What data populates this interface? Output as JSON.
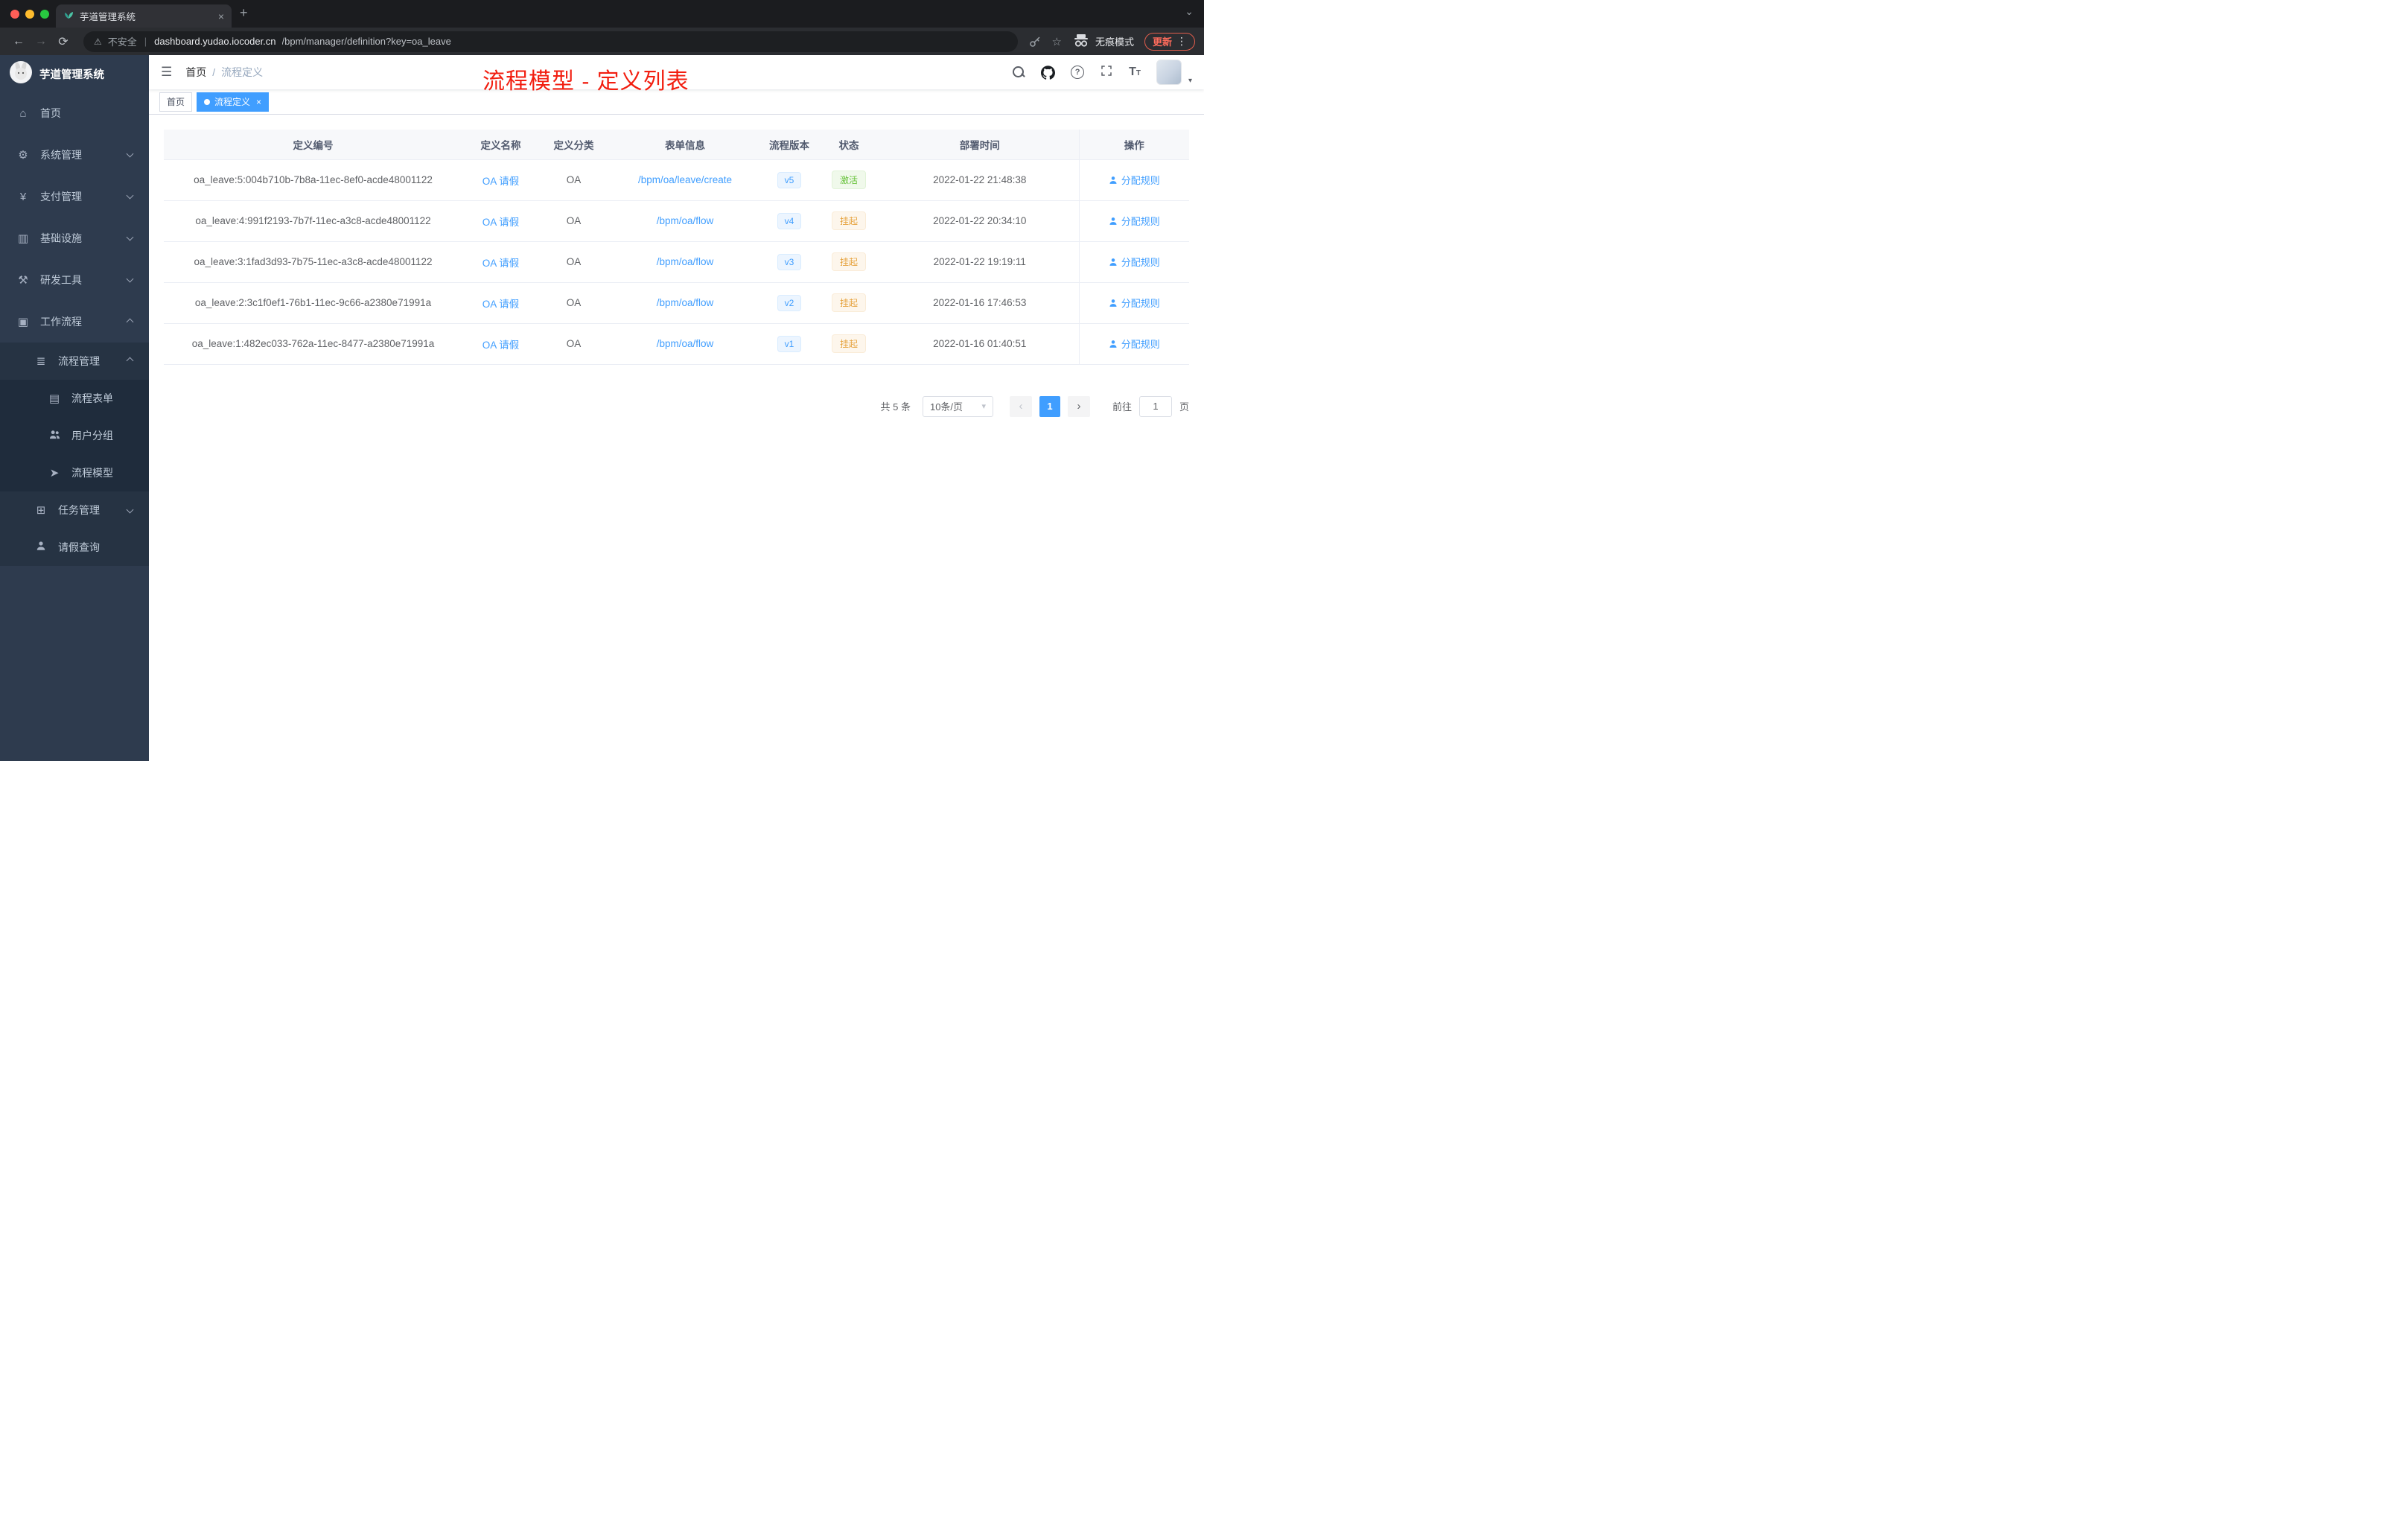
{
  "icons": {
    "close": "×",
    "plus": "+",
    "chevron_down": "⌄",
    "back": "←",
    "forward": "→",
    "reload": "⟳",
    "warning": "⚠",
    "divider": "|",
    "star": "☆",
    "more": "⋮",
    "hamburger": "☰",
    "breadcrumb_sep": "/",
    "caret_down": "▾",
    "prev": "‹",
    "next": "›",
    "help": "?",
    "dashboard": "⌂",
    "gear": "⚙",
    "yen": "¥",
    "infra": "▥",
    "tools": "⚒",
    "workflow": "▣",
    "list": "≣",
    "form": "▤",
    "send": "➤",
    "tasks": "⊞"
  },
  "browser": {
    "tab_title": "芋道管理系统",
    "security_label": "不安全",
    "url_host": "dashboard.yudao.iocoder.cn",
    "url_path": "/bpm/manager/definition?key=oa_leave",
    "incognito_label": "无痕模式",
    "update_label": "更新"
  },
  "sidebar": {
    "app_title": "芋道管理系统",
    "items": [
      {
        "label": "首页",
        "level": 1,
        "expanded": null
      },
      {
        "label": "系统管理",
        "level": 1,
        "expanded": false
      },
      {
        "label": "支付管理",
        "level": 1,
        "expanded": false
      },
      {
        "label": "基础设施",
        "level": 1,
        "expanded": false
      },
      {
        "label": "研发工具",
        "level": 1,
        "expanded": false
      },
      {
        "label": "工作流程",
        "level": 1,
        "expanded": true
      },
      {
        "label": "流程管理",
        "level": 2,
        "expanded": true
      },
      {
        "label": "流程表单",
        "level": 3,
        "expanded": null
      },
      {
        "label": "用户分组",
        "level": 3,
        "expanded": null
      },
      {
        "label": "流程模型",
        "level": 3,
        "expanded": null
      },
      {
        "label": "任务管理",
        "level": 2,
        "expanded": false
      },
      {
        "label": "请假查询",
        "level": 2,
        "expanded": null
      }
    ]
  },
  "header": {
    "breadcrumb": [
      "首页",
      "流程定义"
    ],
    "annotation": "流程模型 - 定义列表"
  },
  "tags": [
    {
      "label": "首页",
      "active": false
    },
    {
      "label": "流程定义",
      "active": true
    }
  ],
  "table": {
    "columns": [
      "定义编号",
      "定义名称",
      "定义分类",
      "表单信息",
      "流程版本",
      "状态",
      "部署时间",
      "操作"
    ],
    "rows": [
      {
        "id": "oa_leave:5:004b710b-7b8a-11ec-8ef0-acde48001122",
        "name": "OA 请假",
        "category": "OA",
        "form": "/bpm/oa/leave/create",
        "version": "v5",
        "status": "激活",
        "status_type": "success",
        "deployed": "2022-01-22 21:48:38",
        "action": "分配规则"
      },
      {
        "id": "oa_leave:4:991f2193-7b7f-11ec-a3c8-acde48001122",
        "name": "OA 请假",
        "category": "OA",
        "form": "/bpm/oa/flow",
        "version": "v4",
        "status": "挂起",
        "status_type": "warning",
        "deployed": "2022-01-22 20:34:10",
        "action": "分配规则"
      },
      {
        "id": "oa_leave:3:1fad3d93-7b75-11ec-a3c8-acde48001122",
        "name": "OA 请假",
        "category": "OA",
        "form": "/bpm/oa/flow",
        "version": "v3",
        "status": "挂起",
        "status_type": "warning",
        "deployed": "2022-01-22 19:19:11",
        "action": "分配规则"
      },
      {
        "id": "oa_leave:2:3c1f0ef1-76b1-11ec-9c66-a2380e71991a",
        "name": "OA 请假",
        "category": "OA",
        "form": "/bpm/oa/flow",
        "version": "v2",
        "status": "挂起",
        "status_type": "warning",
        "deployed": "2022-01-16 17:46:53",
        "action": "分配规则"
      },
      {
        "id": "oa_leave:1:482ec033-762a-11ec-8477-a2380e71991a",
        "name": "OA 请假",
        "category": "OA",
        "form": "/bpm/oa/flow",
        "version": "v1",
        "status": "挂起",
        "status_type": "warning",
        "deployed": "2022-01-16 01:40:51",
        "action": "分配规则"
      }
    ]
  },
  "pagination": {
    "total": "共 5 条",
    "page_size": "10条/页",
    "current_page": "1",
    "goto_label": "前往",
    "goto_value": "1",
    "page_unit": "页"
  },
  "colors": {
    "accent": "#409eff",
    "success": "#67c23a",
    "warning": "#e6a23c",
    "annotation_red": "#f21e10",
    "sidebar_bg": "#2e3b4e"
  }
}
